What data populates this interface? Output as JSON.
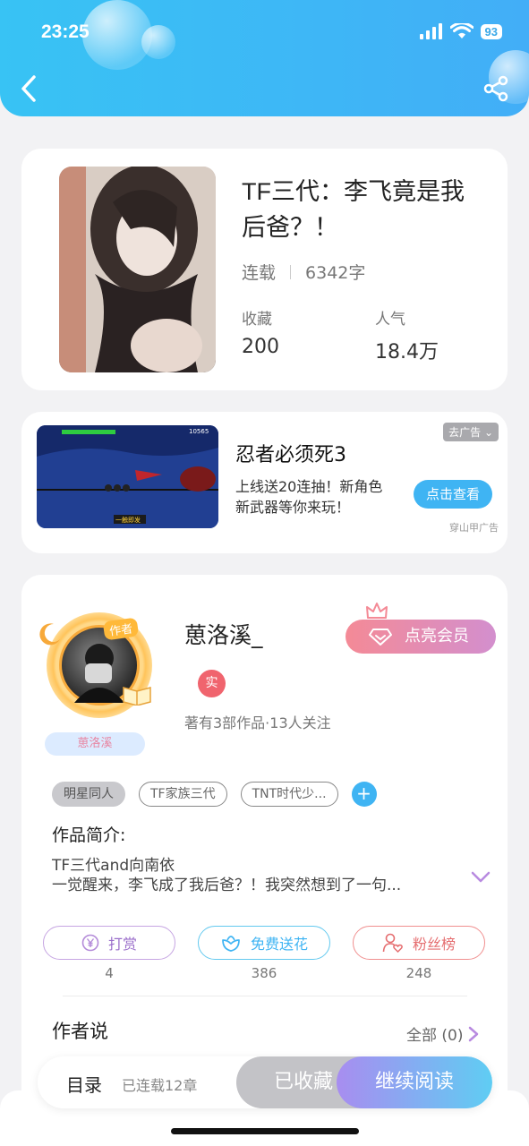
{
  "status_bar": {
    "time": "23:25",
    "battery": "93"
  },
  "book": {
    "title": "TF三代：李飞竟是我后爸？！",
    "status": "连载",
    "word_count": "6342字",
    "favorites_label": "收藏",
    "favorites_value": "200",
    "popularity_label": "人气",
    "popularity_value": "18.4万"
  },
  "ad": {
    "close_label": "去广告",
    "title": "忍者必须死3",
    "description": "上线送20连抽！新角色新武器等你来玩！",
    "cta_label": "点击查看",
    "source": "穿山甲广告",
    "thumb_score": "10565",
    "thumb_banner": "一触即发"
  },
  "author": {
    "badge": "作者",
    "name": "葸洛溪_",
    "name_tag": "葸洛溪",
    "vip_button": "点亮会员",
    "real_badge": "实",
    "stats": "著有3部作品·13人关注"
  },
  "tags": [
    {
      "label": "明星同人"
    },
    {
      "label": "TF家族三代"
    },
    {
      "label": "TNT时代少..."
    }
  ],
  "tag_add": "+",
  "intro": {
    "label": "作品简介:",
    "line1": "TF三代and向南依",
    "line2": "一觉醒来，李飞成了我后爸？！我突然想到了一句..."
  },
  "actions": {
    "tip": {
      "label": "打赏",
      "count": "4"
    },
    "flower": {
      "label": "免费送花",
      "count": "386"
    },
    "fans": {
      "label": "粉丝榜",
      "count": "248"
    }
  },
  "author_says": {
    "label": "作者说",
    "all": "全部 (0)"
  },
  "bottom_bar": {
    "toc": "目录",
    "chapters": "已连载12章",
    "collected": "已收藏",
    "continue": "继续阅读"
  },
  "colors": {
    "header": "#38c3f4",
    "accent_blue": "#3fb4f3",
    "vip_pink": "#f48a96",
    "real_red": "#f0646e"
  }
}
